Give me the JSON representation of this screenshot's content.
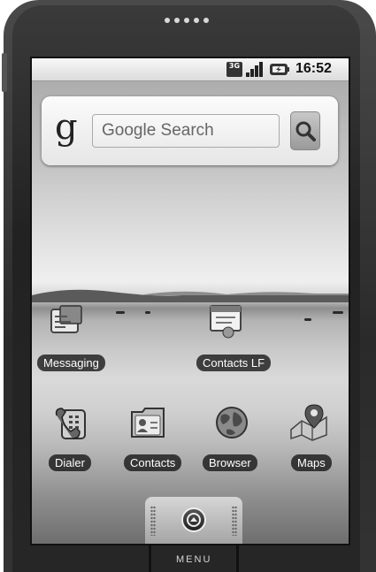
{
  "status_bar": {
    "network_badge": "3G",
    "time": "16:52",
    "icons": [
      "3g-icon",
      "signal-icon",
      "battery-icon"
    ]
  },
  "search_widget": {
    "logo": "g",
    "placeholder": "Google Search",
    "button_icon": "search-icon"
  },
  "apps_row1": [
    {
      "label": "Messaging",
      "icon": "messaging-icon"
    },
    {
      "label": "Contacts LF",
      "icon": "contacts-lf-icon"
    }
  ],
  "apps_row2": [
    {
      "label": "Dialer",
      "icon": "dialer-icon"
    },
    {
      "label": "Contacts",
      "icon": "contacts-icon"
    },
    {
      "label": "Browser",
      "icon": "browser-icon"
    },
    {
      "label": "Maps",
      "icon": "maps-icon"
    }
  ],
  "dock": {
    "launcher_icon": "launcher-arrow-icon"
  },
  "hardware": {
    "menu_label": "MENU"
  }
}
